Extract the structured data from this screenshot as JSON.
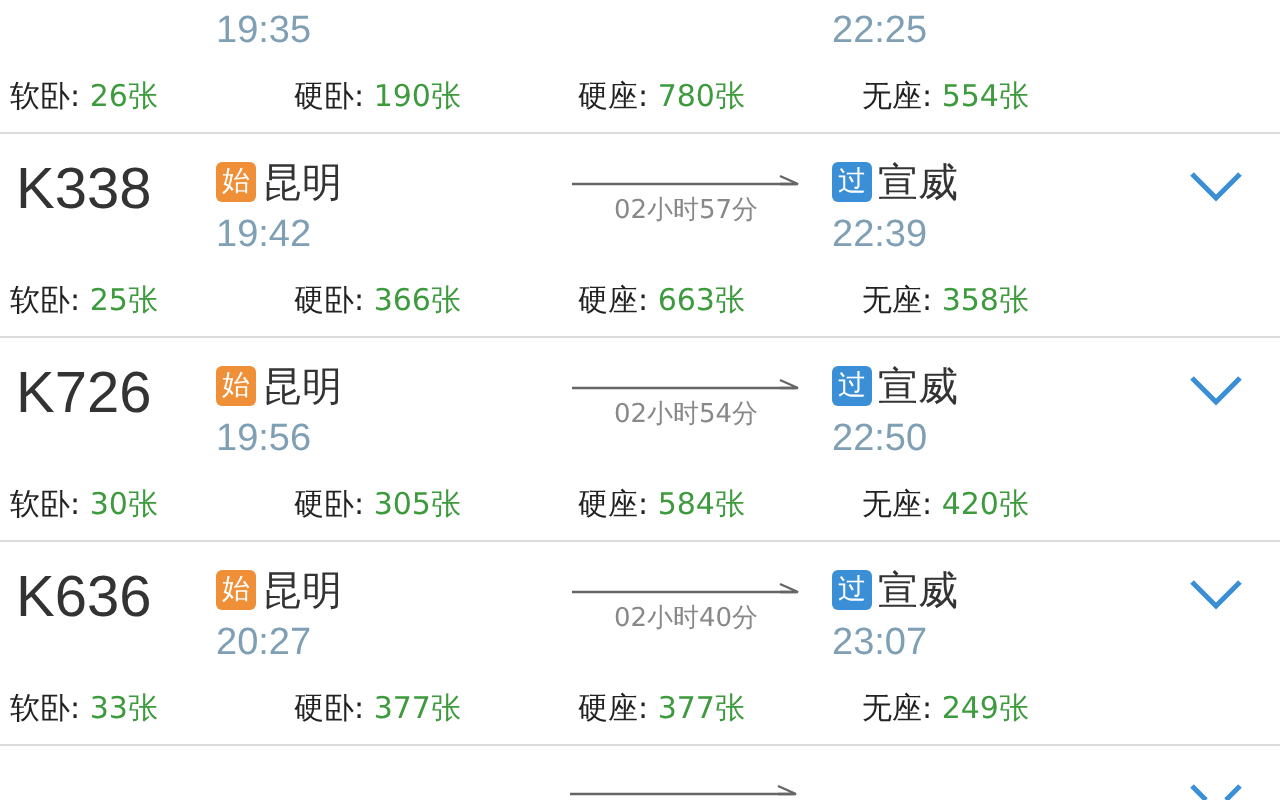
{
  "trains": [
    {
      "departure": {
        "time": "19:35"
      },
      "arrival": {
        "time": "22:25"
      },
      "seats": [
        {
          "label": "软卧:",
          "count": "26张"
        },
        {
          "label": "硬卧:",
          "count": "190张"
        },
        {
          "label": "硬座:",
          "count": "780张"
        },
        {
          "label": "无座:",
          "count": "554张"
        }
      ]
    },
    {
      "train": "K338",
      "departure": {
        "badge": "始",
        "station": "昆明",
        "time": "19:42"
      },
      "duration": "02小时57分",
      "arrival": {
        "badge": "过",
        "station": "宣威",
        "time": "22:39"
      },
      "seats": [
        {
          "label": "软卧:",
          "count": "25张"
        },
        {
          "label": "硬卧:",
          "count": "366张"
        },
        {
          "label": "硬座:",
          "count": "663张"
        },
        {
          "label": "无座:",
          "count": "358张"
        }
      ]
    },
    {
      "train": "K726",
      "departure": {
        "badge": "始",
        "station": "昆明",
        "time": "19:56"
      },
      "duration": "02小时54分",
      "arrival": {
        "badge": "过",
        "station": "宣威",
        "time": "22:50"
      },
      "seats": [
        {
          "label": "软卧:",
          "count": "30张"
        },
        {
          "label": "硬卧:",
          "count": "305张"
        },
        {
          "label": "硬座:",
          "count": "584张"
        },
        {
          "label": "无座:",
          "count": "420张"
        }
      ]
    },
    {
      "train": "K636",
      "departure": {
        "badge": "始",
        "station": "昆明",
        "time": "20:27"
      },
      "duration": "02小时40分",
      "arrival": {
        "badge": "过",
        "station": "宣威",
        "time": "23:07"
      },
      "seats": [
        {
          "label": "软卧:",
          "count": "33张"
        },
        {
          "label": "硬卧:",
          "count": "377张"
        },
        {
          "label": "硬座:",
          "count": "377张"
        },
        {
          "label": "无座:",
          "count": "249张"
        }
      ]
    }
  ]
}
